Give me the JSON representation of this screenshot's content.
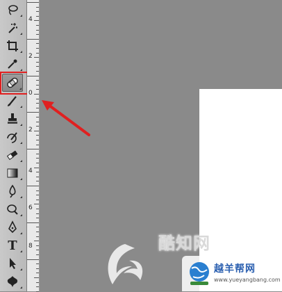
{
  "toolbox": {
    "tools": [
      {
        "name": "lasso-tool-icon"
      },
      {
        "name": "magic-wand-tool-icon"
      },
      {
        "name": "crop-tool-icon"
      },
      {
        "name": "eyedropper-tool-icon"
      },
      {
        "name": "spot-healing-brush-tool-icon",
        "selected": true
      },
      {
        "name": "brush-tool-icon"
      },
      {
        "name": "clone-stamp-tool-icon"
      },
      {
        "name": "history-brush-tool-icon"
      },
      {
        "name": "eraser-tool-icon"
      },
      {
        "name": "gradient-tool-icon"
      },
      {
        "name": "blur-tool-icon"
      },
      {
        "name": "dodge-tool-icon"
      },
      {
        "name": "pen-tool-icon"
      },
      {
        "name": "type-tool-icon",
        "glyph": "T"
      },
      {
        "name": "path-selection-tool-icon"
      },
      {
        "name": "custom-shape-tool-icon"
      }
    ]
  },
  "ruler": {
    "labels": [
      "4",
      "2",
      "0",
      "2",
      "4",
      "6",
      "8"
    ]
  },
  "annotation": {
    "highlight_color": "#e02020",
    "arrow_color": "#e02020"
  },
  "watermarks": {
    "kuzhi": "酷知网",
    "site_name": "越羊帮网",
    "site_url": "www.yueyangbang.com"
  }
}
